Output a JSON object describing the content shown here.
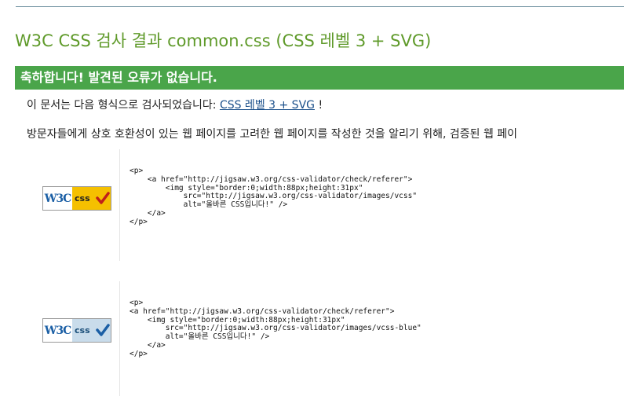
{
  "page": {
    "title": "W3C CSS 검사 결과 common.css (CSS 레벨 3 + SVG)",
    "banner": "축하합니다! 발견된 오류가 없습니다.",
    "line1_prefix": "이 문서는 다음 형식으로 검사되었습니다:",
    "line1_link": "CSS 레벨 3 + SVG",
    "line1_suffix": "!",
    "line2": "방문자들에게 상호 호환성이 있는 웹 페이지를 고려한 웹 페이지를 작성한 것을 알리기 위해, 검증된 웹 페이"
  },
  "badges": [
    {
      "w3c_text": "W3C",
      "css_text": "css",
      "icon": "w3c-css-valid-gold-badge",
      "code": "<p>\n    <a href=\"http://jigsaw.w3.org/css-validator/check/referer\">\n        <img style=\"border:0;width:88px;height:31px\"\n            src=\"http://jigsaw.w3.org/css-validator/images/vcss\"\n            alt=\"올바른 CSS입니다!\" />\n    </a>\n</p>"
    },
    {
      "w3c_text": "W3C",
      "css_text": "css",
      "icon": "w3c-css-valid-blue-badge",
      "code": "<p>\n<a href=\"http://jigsaw.w3.org/css-validator/check/referer\">\n    <img style=\"border:0;width:88px;height:31px\"\n        src=\"http://jigsaw.w3.org/css-validator/images/vcss-blue\"\n        alt=\"올바른 CSS입니다!\" />\n    </a>\n</p>"
    }
  ],
  "colors": {
    "title": "#5f9a2a",
    "banner_bg": "#4aa54a",
    "link": "#1a4f8a",
    "badge_gold": "#f5c000",
    "badge_blue": "#c9dceb",
    "check_red": "#c0201a",
    "check_blue": "#1b5fa5"
  }
}
